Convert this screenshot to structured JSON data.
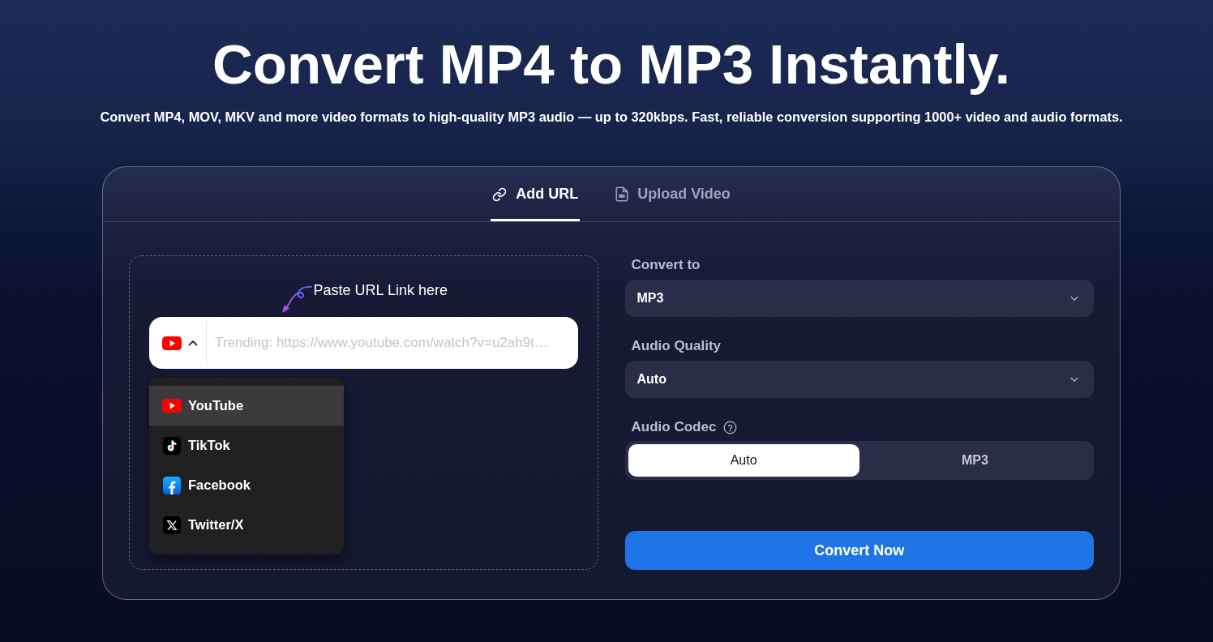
{
  "hero": {
    "title": "Convert MP4 to MP3 Instantly.",
    "subtitle": "Convert MP4, MOV, MKV and more video formats to high-quality MP3 audio — up to 320kbps. Fast, reliable conversion supporting 1000+ video and audio formats."
  },
  "converter": {
    "tabs": [
      {
        "label": "Add URL",
        "kind": "link",
        "selected": true
      },
      {
        "label": "Upload Video",
        "kind": "file",
        "selected": false
      }
    ],
    "url_panel": {
      "hint": "Paste URL Link here",
      "url_field": {
        "placeholder": "Trending: https://www.youtube.com/watch?v=u2ah9t…"
      },
      "platform_menu": {
        "expanded": true,
        "items": [
          {
            "label": "YouTube",
            "kind": "youtube",
            "selected": true
          },
          {
            "label": "TikTok",
            "kind": "tiktok",
            "selected": false
          },
          {
            "label": "Facebook",
            "kind": "facebook",
            "selected": false
          },
          {
            "label": "Twitter/X",
            "kind": "x",
            "selected": false
          }
        ]
      }
    },
    "settings": {
      "fields": [
        {
          "label": "Convert to",
          "kind": "select",
          "help": false,
          "value": "MP3"
        },
        {
          "label": "Audio Quality",
          "kind": "select",
          "help": false,
          "value": "Auto"
        },
        {
          "label": "Audio Codec",
          "kind": "segmented",
          "help": true,
          "options": [
            {
              "label": "Auto",
              "selected": true
            },
            {
              "label": "MP3",
              "selected": false
            }
          ]
        }
      ],
      "submit": {
        "label": "Convert Now"
      }
    }
  }
}
